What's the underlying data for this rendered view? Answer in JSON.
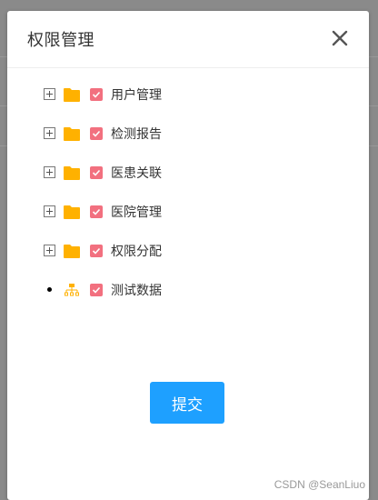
{
  "dialog": {
    "title": "权限管理",
    "close_icon": "close-icon",
    "submit_label": "提交"
  },
  "tree": {
    "nodes": [
      {
        "label": "用户管理",
        "expander": "plus-box-icon",
        "type_icon": "folder-icon",
        "checked": true
      },
      {
        "label": "检测报告",
        "expander": "plus-box-icon",
        "type_icon": "folder-icon",
        "checked": true
      },
      {
        "label": "医患关联",
        "expander": "plus-box-icon",
        "type_icon": "folder-icon",
        "checked": true
      },
      {
        "label": "医院管理",
        "expander": "plus-box-icon",
        "type_icon": "folder-icon",
        "checked": true
      },
      {
        "label": "权限分配",
        "expander": "plus-box-icon",
        "type_icon": "folder-icon",
        "checked": true
      },
      {
        "label": "测试数据",
        "expander": "bullet-icon",
        "type_icon": "sitemap-icon",
        "checked": true
      }
    ]
  },
  "watermark": "CSDN @SeanLiuo",
  "colors": {
    "folder": "#ffb100",
    "checkbox": "#f2707f",
    "primary_button": "#1ea0ff",
    "overlay": "#8a8a8a"
  }
}
